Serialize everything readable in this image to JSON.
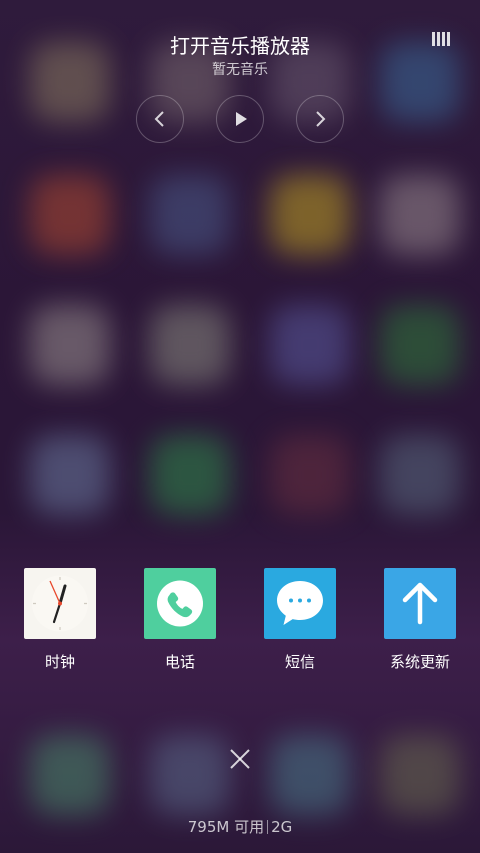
{
  "music": {
    "title": "打开音乐播放器",
    "subtitle": "暂无音乐",
    "icons": {
      "playlist": "playlist-icon",
      "prev": "chevron-left-icon",
      "play": "play-icon",
      "next": "chevron-right-icon"
    }
  },
  "recent_apps": [
    {
      "label": "时钟",
      "icon": "clock-icon",
      "bg": "#f7f5f0"
    },
    {
      "label": "电话",
      "icon": "phone-icon",
      "bg": "#4fcf9e"
    },
    {
      "label": "短信",
      "icon": "message-icon",
      "bg": "#2aa9e0"
    },
    {
      "label": "系统更新",
      "icon": "update-arrow-icon",
      "bg": "#3aa6e6"
    }
  ],
  "footer": {
    "memory_free": "795M 可用",
    "memory_total": "2G",
    "close_icon": "close-icon"
  }
}
